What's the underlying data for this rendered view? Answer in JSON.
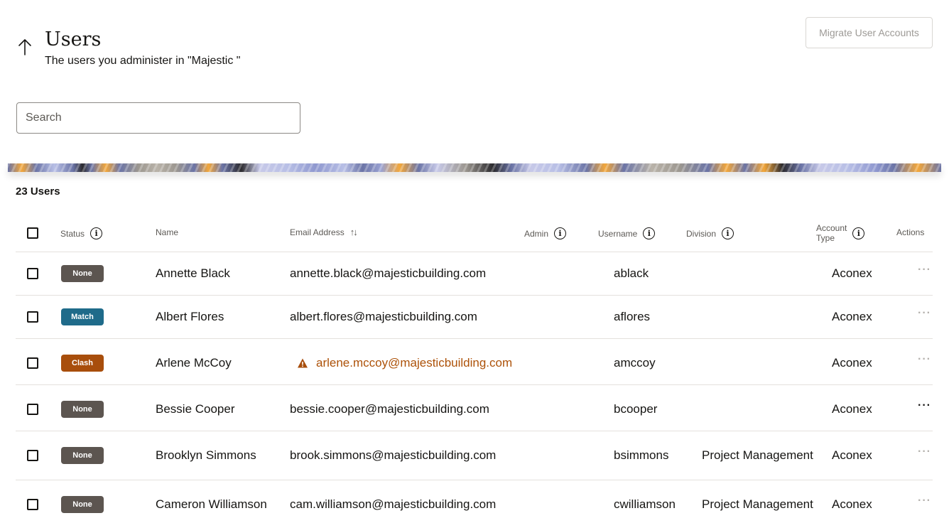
{
  "header": {
    "back_icon": "arrow-up-icon",
    "title": "Users",
    "subtitle": "The users you administer in \"Majestic \""
  },
  "toolbar": {
    "migrate_label": "Migrate User Accounts"
  },
  "search": {
    "placeholder": "Search"
  },
  "user_count": "23 Users",
  "table": {
    "columns": {
      "status": "Status",
      "name": "Name",
      "email": "Email Address",
      "admin": "Admin",
      "username": "Username",
      "division": "Division",
      "account_type_line1": "Account",
      "account_type_line2": "Type",
      "actions": "Actions"
    },
    "actions_glyph": "···",
    "rows": [
      {
        "status": "None",
        "status_color": "#5c5550",
        "name": "Annette Black",
        "email": "annette.black@majesticbuilding.com",
        "username": "ablack",
        "division": "",
        "account_type": "Aconex"
      },
      {
        "status": "Match",
        "status_color": "#1f6b8a",
        "name": "Albert Flores",
        "email": "albert.flores@majesticbuilding.com",
        "username": "aflores",
        "division": "",
        "account_type": "Aconex"
      },
      {
        "status": "Clash",
        "status_color": "#a84e0c",
        "name": "Arlene McCoy",
        "email": "arlene.mccoy@majesticbuilding.com",
        "username": "amccoy",
        "division": "",
        "account_type": "Aconex",
        "warning": true
      },
      {
        "status": "None",
        "status_color": "#5c5550",
        "name": "Bessie Cooper",
        "email": "bessie.cooper@majesticbuilding.com",
        "username": "bcooper",
        "division": "",
        "account_type": "Aconex",
        "actions_active": true
      },
      {
        "status": "None",
        "status_color": "#5c5550",
        "name": "Brooklyn Simmons",
        "email": "brook.simmons@majesticbuilding.com",
        "username": "bsimmons",
        "division": "Project Management",
        "account_type": "Aconex"
      },
      {
        "status": "None",
        "status_color": "#5c5550",
        "name": "Cameron Williamson",
        "email": "cam.williamson@majesticbuilding.com",
        "username": "cwilliamson",
        "division": "Project Management",
        "account_type": "Aconex"
      }
    ]
  }
}
